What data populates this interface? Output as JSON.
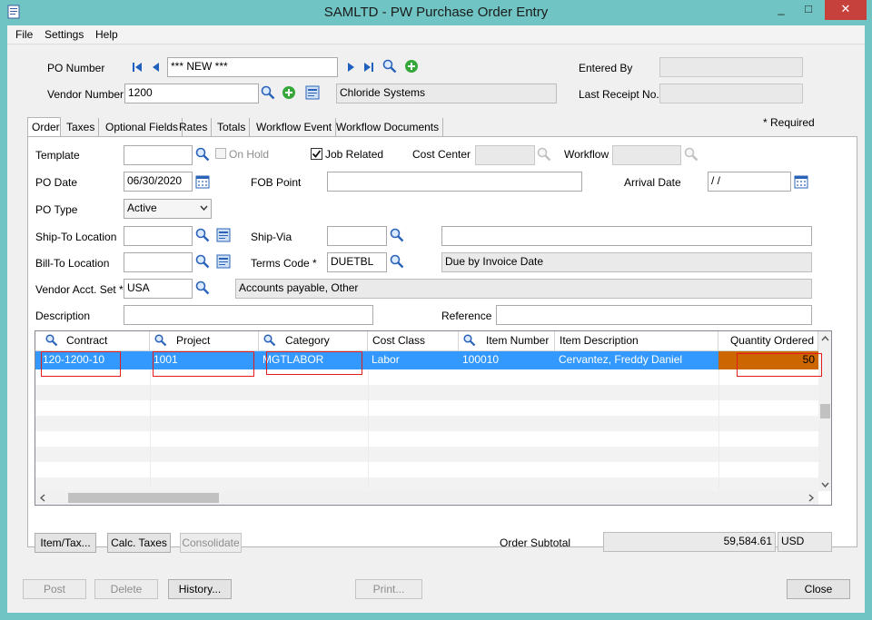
{
  "window": {
    "title": "SAMLTD - PW Purchase Order Entry",
    "minimize": "_",
    "maximize": "□",
    "close": "✕"
  },
  "menu": {
    "file": "File",
    "settings": "Settings",
    "help": "Help"
  },
  "header": {
    "po_number_label": "PO Number",
    "po_number_value": "*** NEW ***",
    "vendor_number_label": "Vendor Number *",
    "vendor_number_value": "1200",
    "vendor_name": "Chloride Systems",
    "entered_by_label": "Entered By",
    "entered_by_value": "",
    "last_receipt_label": "Last Receipt No.",
    "last_receipt_value": ""
  },
  "tabs": [
    "Order",
    "Taxes",
    "Optional Fields",
    "Rates",
    "Totals",
    "Workflow Event",
    "Workflow Documents"
  ],
  "required_note": "* Required",
  "order": {
    "template_label": "Template",
    "template_value": "",
    "on_hold_label": "On Hold",
    "job_related_label": "Job Related",
    "cost_center_label": "Cost Center",
    "cost_center_value": "",
    "workflow_label": "Workflow",
    "workflow_value": "",
    "po_date_label": "PO Date",
    "po_date_value": "06/30/2020",
    "fob_label": "FOB Point",
    "fob_value": "",
    "arrival_label": "Arrival Date",
    "arrival_value": "/ /",
    "po_type_label": "PO Type",
    "po_type_value": "Active",
    "ship_to_label": "Ship-To Location",
    "ship_to_value": "",
    "ship_via_label": "Ship-Via",
    "ship_via_value": "",
    "ship_via_desc": "",
    "bill_to_label": "Bill-To Location",
    "bill_to_value": "",
    "terms_label": "Terms Code *",
    "terms_value": "DUETBL",
    "terms_desc": "Due by Invoice Date",
    "vendor_acct_label": "Vendor Acct. Set *",
    "vendor_acct_value": "USA",
    "vendor_acct_desc": "Accounts payable, Other",
    "description_label": "Description",
    "description_value": "",
    "reference_label": "Reference",
    "reference_value": ""
  },
  "grid": {
    "columns": [
      "Contract",
      "Project",
      "Category",
      "Cost Class",
      "Item Number",
      "Item Description",
      "Quantity Ordered"
    ],
    "rows": [
      [
        "120-1200-10",
        "1001",
        "MGTLABOR",
        "Labor",
        "100010",
        "Cervantez, Freddy Daniel",
        "50"
      ]
    ]
  },
  "footer": {
    "item_tax": "Item/Tax...",
    "calc_taxes": "Calc. Taxes",
    "consolidate": "Consolidate",
    "order_subtotal_label": "Order Subtotal",
    "order_subtotal_value": "59,584.61",
    "currency": "USD",
    "post": "Post",
    "delete": "Delete",
    "history": "History...",
    "print": "Print...",
    "close": "Close"
  },
  "colors": {
    "selection": "#3399ff",
    "qty_cell": "#cc6600",
    "highlight_box": "#e41c1c",
    "title_bg": "#70c4c4"
  }
}
